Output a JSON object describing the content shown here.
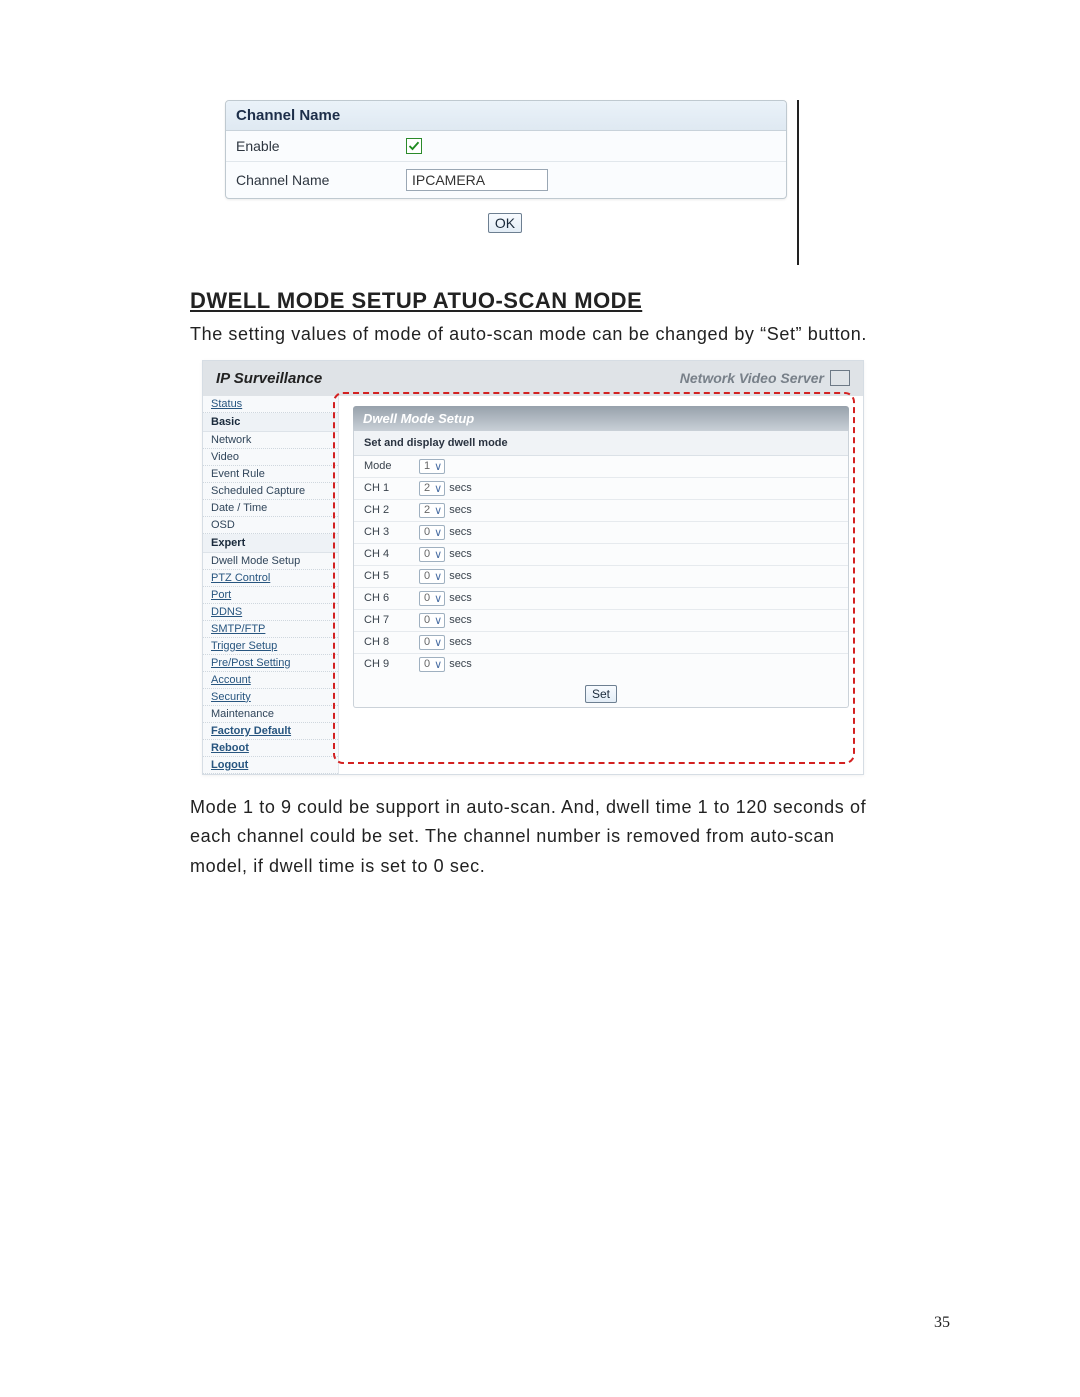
{
  "channel_panel": {
    "header": "Channel Name",
    "rows": {
      "enable_label": "Enable",
      "channel_name_label": "Channel Name",
      "channel_name_value": "IPCAMERA"
    },
    "ok_label": "OK"
  },
  "heading": "DWELL MODE SETUP ATUO-SCAN MODE",
  "para1": "The setting values of mode of auto-scan mode can be changed by “Set” button.",
  "surveillance": {
    "title": "IP Surveillance",
    "right_label": "Network Video Server",
    "sidebar": {
      "status": "Status",
      "basic": "Basic",
      "network": "Network",
      "video": "Video",
      "event_rule": "Event Rule",
      "scheduled_capture": "Scheduled Capture",
      "date_time": "Date / Time",
      "osd": "OSD",
      "expert": "Expert",
      "dwell_mode_setup": "Dwell Mode Setup",
      "ptz_control": "PTZ Control",
      "port": "Port",
      "ddns": "DDNS",
      "smtp_ftp": "SMTP/FTP",
      "trigger_setup": "Trigger Setup",
      "pre_post": "Pre/Post Setting",
      "account": "Account",
      "security": "Security",
      "maintenance": "Maintenance",
      "factory_default": "Factory Default",
      "reboot": "Reboot",
      "logout": "Logout"
    },
    "dwell": {
      "header": "Dwell Mode Setup",
      "subheader": "Set and display dwell mode",
      "mode_label": "Mode",
      "mode_value": "1",
      "secs_label": "secs",
      "channels": [
        {
          "label": "CH 1",
          "value": "2"
        },
        {
          "label": "CH 2",
          "value": "2"
        },
        {
          "label": "CH 3",
          "value": "0"
        },
        {
          "label": "CH 4",
          "value": "0"
        },
        {
          "label": "CH 5",
          "value": "0"
        },
        {
          "label": "CH 6",
          "value": "0"
        },
        {
          "label": "CH 7",
          "value": "0"
        },
        {
          "label": "CH 8",
          "value": "0"
        },
        {
          "label": "CH 9",
          "value": "0"
        }
      ],
      "set_label": "Set"
    }
  },
  "para2": "Mode 1 to 9 could be support in auto-scan. And, dwell time 1 to 120 seconds of each channel could be set. The channel number is removed from auto-scan model, if dwell time is set to 0 sec.",
  "page_number": "35"
}
